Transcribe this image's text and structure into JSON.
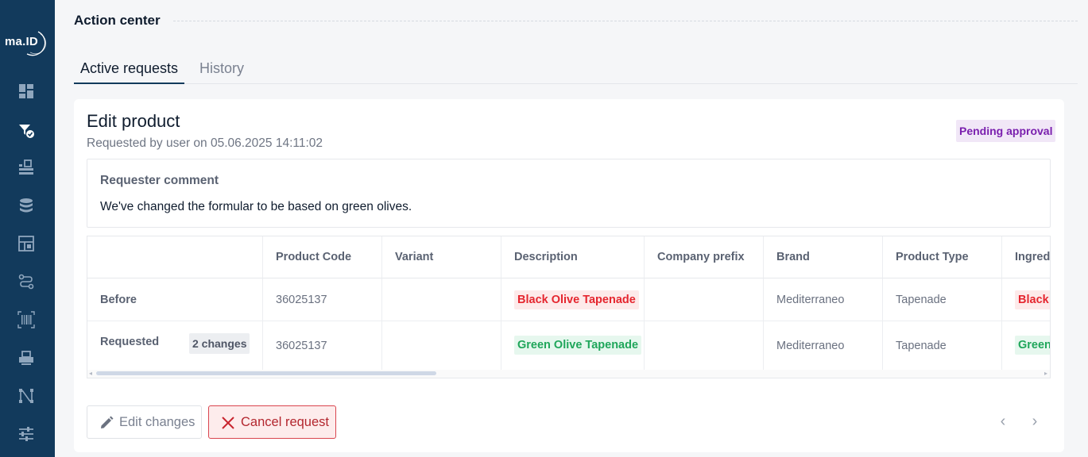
{
  "sidebar": {
    "logo_text": "ma.ID",
    "items": [
      {
        "icon": "dashboard-icon"
      },
      {
        "icon": "action-center-icon"
      },
      {
        "icon": "products-icon"
      },
      {
        "icon": "database-icon"
      },
      {
        "icon": "layout-icon"
      },
      {
        "icon": "workflow-icon"
      },
      {
        "icon": "barcode-icon"
      },
      {
        "icon": "printer-icon"
      },
      {
        "icon": "mapping-icon"
      },
      {
        "icon": "settings-sliders-icon"
      }
    ]
  },
  "header": {
    "title": "Action center"
  },
  "tabs": [
    {
      "label": "Active requests",
      "active": true
    },
    {
      "label": "History",
      "active": false
    }
  ],
  "request": {
    "title": "Edit product",
    "subtitle": "Requested by user on 05.06.2025 14:11:02",
    "status": "Pending approval",
    "comment_label": "Requester comment",
    "comment_text": "We've changed the formular to be based on green olives."
  },
  "table": {
    "columns": [
      "",
      "Product Code",
      "Variant",
      "Description",
      "Company prefix",
      "Brand",
      "Product Type",
      "Ingredi"
    ],
    "rows": [
      {
        "label": "Before",
        "product_code": "36025137",
        "variant": "",
        "description": "Black Olive Tapenade",
        "company_prefix": "",
        "brand": "Mediterraneo",
        "product_type": "Tapenade",
        "ingredients": "Black O"
      },
      {
        "label": "Requested",
        "changes": "2 changes",
        "product_code": "36025137",
        "variant": "",
        "description": "Green Olive Tapenade",
        "company_prefix": "",
        "brand": "Mediterraneo",
        "product_type": "Tapenade",
        "ingredients": "Green"
      }
    ]
  },
  "actions": {
    "edit_label": "Edit changes",
    "cancel_label": "Cancel request"
  },
  "colors": {
    "sidebar": "#123a5c",
    "removed": "#e5262f",
    "added": "#1fa65a",
    "pending": "#7a1fae"
  }
}
